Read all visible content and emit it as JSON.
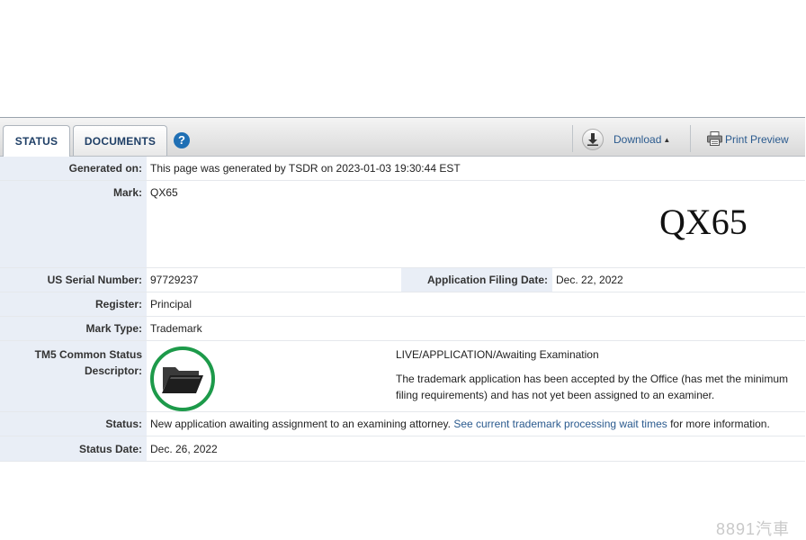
{
  "tabs": {
    "status": "STATUS",
    "documents": "DOCUMENTS",
    "help": "?"
  },
  "toolbar": {
    "download": "Download",
    "print_preview": "Print Preview"
  },
  "rows": {
    "generated_label": "Generated on:",
    "generated_value": "This page was generated by TSDR on 2023-01-03 19:30:44 EST",
    "mark_label": "Mark:",
    "mark_value": "QX65",
    "mark_image_text": "QX65",
    "serial_label": "US Serial Number:",
    "serial_value": "97729237",
    "filing_label": "Application Filing Date:",
    "filing_value": "Dec. 22, 2022",
    "register_label": "Register:",
    "register_value": "Principal",
    "marktype_label": "Mark Type:",
    "marktype_value": "Trademark",
    "tm5_label_line1": "TM5 Common Status",
    "tm5_label_line2": "Descriptor:",
    "tm5_title": "LIVE/APPLICATION/Awaiting Examination",
    "tm5_desc": "The trademark application has been accepted by the Office (has met the minimum filing requirements) and has not yet been assigned to an examiner.",
    "status_label": "Status:",
    "status_text": "New application awaiting assignment to an examining attorney.",
    "status_link": "See current trademark processing wait times",
    "status_suffix": "for more information.",
    "status_date_label": "Status Date:",
    "status_date_value": "Dec. 26, 2022"
  },
  "watermark": "8891汽車",
  "colors": {
    "accent_blue": "#1f6fb4",
    "link": "#2a5a8e",
    "status_ring": "#1d9a4a",
    "label_bg": "#e9eef6"
  },
  "icons": {
    "help": "help-circle-icon",
    "download": "download-arrow-icon",
    "print": "printer-icon",
    "status": "open-folder-icon"
  }
}
